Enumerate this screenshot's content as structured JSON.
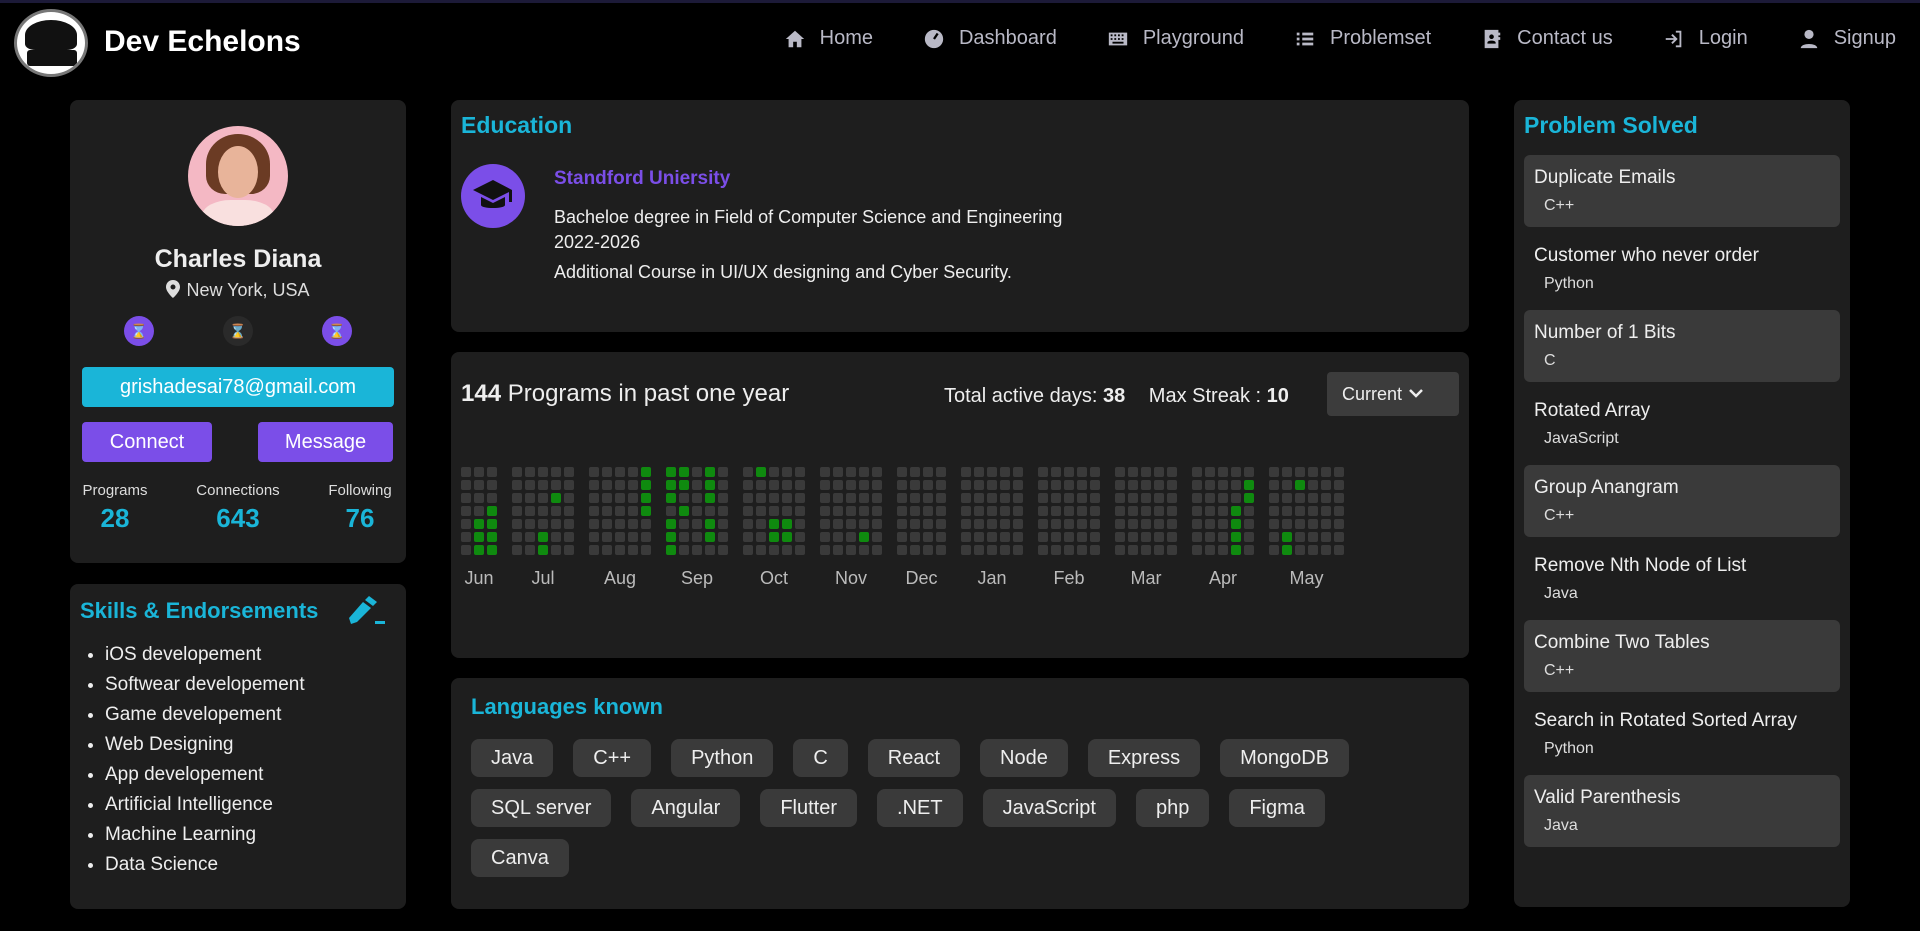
{
  "nav": {
    "brand": "Dev Echelons",
    "links": [
      "Home",
      "Dashboard",
      "Playground",
      "Problemset",
      "Contact us",
      "Login",
      "Signup"
    ]
  },
  "profile": {
    "name": "Charles Diana",
    "location": "New York, USA",
    "email": "grishadesai78@gmail.com",
    "connect_label": "Connect",
    "message_label": "Message",
    "stats": [
      {
        "label": "Programs",
        "value": "28"
      },
      {
        "label": "Connections",
        "value": "643"
      },
      {
        "label": "Following",
        "value": "76"
      }
    ]
  },
  "skills": {
    "title": "Skills & Endorsements",
    "items": [
      "iOS developement",
      "Softwear developement",
      "Game developement",
      "Web Designing",
      "App developement",
      "Artificial Intelligence",
      "Machine Learning",
      "Data Science"
    ]
  },
  "education": {
    "title": "Education",
    "university": "Standford Uniersity",
    "degree": "Bacheloe degree in Field of Computer Science and Engineering",
    "years": "2022-2026",
    "additional": "Additional Course in UI/UX designing and Cyber Security."
  },
  "activity": {
    "count": "144",
    "title_suffix": "Programs in past one year",
    "active_days_label": "Total active days:",
    "active_days": "38",
    "max_streak_label": "Max Streak :",
    "max_streak": "10",
    "dropdown": "Current",
    "months": [
      {
        "label": "Jun",
        "weeks": 3,
        "active": [
          [
            1,
            6
          ],
          [
            1,
            5
          ],
          [
            1,
            4
          ],
          [
            2,
            3
          ],
          [
            2,
            4
          ],
          [
            2,
            5
          ],
          [
            2,
            6
          ],
          [
            1,
            7
          ],
          [
            2,
            7
          ]
        ]
      },
      {
        "label": "Jul",
        "weeks": 5,
        "active": [
          [
            3,
            2
          ],
          [
            2,
            5
          ],
          [
            2,
            6
          ]
        ]
      },
      {
        "label": "Aug",
        "weeks": 5,
        "active": [
          [
            4,
            0
          ],
          [
            4,
            1
          ],
          [
            4,
            2
          ],
          [
            4,
            3
          ]
        ]
      },
      {
        "label": "Sep",
        "weeks": 5,
        "active": [
          [
            0,
            0
          ],
          [
            0,
            1
          ],
          [
            0,
            2
          ],
          [
            0,
            4
          ],
          [
            0,
            5
          ],
          [
            0,
            6
          ],
          [
            0,
            7
          ],
          [
            1,
            0
          ],
          [
            1,
            1
          ],
          [
            1,
            3
          ],
          [
            3,
            0
          ],
          [
            3,
            1
          ],
          [
            3,
            2
          ],
          [
            3,
            4
          ],
          [
            3,
            5
          ]
        ]
      },
      {
        "label": "Oct",
        "weeks": 5,
        "active": [
          [
            1,
            0
          ],
          [
            2,
            4
          ],
          [
            2,
            5
          ],
          [
            3,
            5
          ],
          [
            3,
            4
          ]
        ]
      },
      {
        "label": "Nov",
        "weeks": 5,
        "active": [
          [
            3,
            5
          ]
        ]
      },
      {
        "label": "Dec",
        "weeks": 4,
        "active": []
      },
      {
        "label": "Jan",
        "weeks": 5,
        "active": []
      },
      {
        "label": "Feb",
        "weeks": 5,
        "active": []
      },
      {
        "label": "Mar",
        "weeks": 5,
        "active": []
      },
      {
        "label": "Apr",
        "weeks": 5,
        "active": [
          [
            4,
            1
          ],
          [
            4,
            2
          ],
          [
            3,
            3
          ],
          [
            3,
            4
          ],
          [
            3,
            5
          ],
          [
            3,
            6
          ],
          [
            3,
            7
          ]
        ]
      },
      {
        "label": "May",
        "weeks": 6,
        "active": [
          [
            1,
            5
          ],
          [
            1,
            6
          ],
          [
            1,
            7
          ],
          [
            2,
            1
          ]
        ]
      }
    ],
    "colors": {
      "empty": "#3a3a3a",
      "active": "#0f8a0f"
    }
  },
  "languages": {
    "title": "Languages known",
    "items": [
      "Java",
      "C++",
      "Python",
      "C",
      "React",
      "Node",
      "Express",
      "MongoDB",
      "SQL server",
      "Angular",
      "Flutter",
      ".NET",
      "JavaScript",
      "php",
      "Figma",
      "Canva"
    ]
  },
  "problems": {
    "title": "Problem Solved",
    "items": [
      {
        "name": "Duplicate Emails",
        "lang": "C++",
        "shaded": true
      },
      {
        "name": "Customer who never order",
        "lang": "Python",
        "shaded": false
      },
      {
        "name": "Number of 1 Bits",
        "lang": "C",
        "shaded": true
      },
      {
        "name": "Rotated Array",
        "lang": "JavaScript",
        "shaded": false
      },
      {
        "name": "Group Anangram",
        "lang": "C++",
        "shaded": true
      },
      {
        "name": "Remove Nth Node of List",
        "lang": "Java",
        "shaded": false
      },
      {
        "name": "Combine Two Tables",
        "lang": "C++",
        "shaded": true
      },
      {
        "name": "Search in Rotated Sorted Array",
        "lang": "Python",
        "shaded": false
      },
      {
        "name": "Valid Parenthesis",
        "lang": "Java",
        "shaded": true
      }
    ]
  },
  "theme": {
    "accent": "#1ab5d8",
    "purple": "#7b4ee8",
    "card": "#1e1e1e"
  }
}
